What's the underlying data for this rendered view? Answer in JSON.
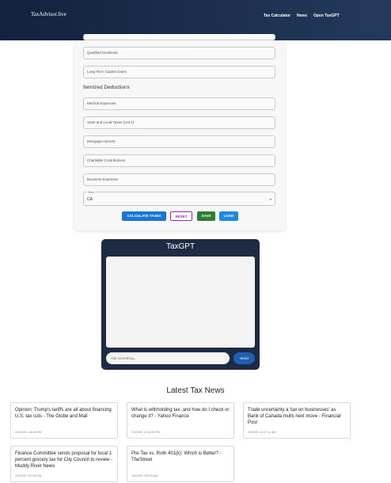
{
  "header": {
    "brand": "TaxAdvisor.live",
    "nav": [
      "Tax Calculator",
      "News",
      "Open TaxGPT"
    ]
  },
  "calculator": {
    "fields": [
      {
        "label": ""
      },
      {
        "label": "Qualified Dividends"
      },
      {
        "label": "Long-Term Capital Gains"
      }
    ],
    "itemized_title": "Itemized Deductions",
    "deductions": [
      {
        "label": "Medical Expenses"
      },
      {
        "label": "State and Local Taxes (SALT)"
      },
      {
        "label": "Mortgage Interest"
      },
      {
        "label": "Charitable Contributions"
      },
      {
        "label": "Business Expenses"
      }
    ],
    "state": {
      "label": "State",
      "value": "CA"
    },
    "buttons": {
      "calculate": "CALCULATE TAXES",
      "reset": "RESET",
      "save": "SAVE",
      "load": "LOAD"
    },
    "colors": {
      "calculate": "#1976d2",
      "reset_border": "#9c27b0",
      "save": "#2e7d32",
      "load": "#1e88e5"
    }
  },
  "taxgpt": {
    "title": "TaxGPT",
    "placeholder": "Ask something...",
    "send": "Send"
  },
  "news": {
    "title": "Latest Tax News",
    "items": [
      {
        "headline": "Opinion: Trump's tariffs are all about financing U.S. tax cuts - The Globe and Mail",
        "date": "2/4/2025, 1:45:30 PM"
      },
      {
        "headline": "What is withholding tax, and how do I check or change it? - Yahoo Finance",
        "date": "2/4/2025, 12:16:25 PM"
      },
      {
        "headline": "Trade uncertainty a 'tax on businesses' as Bank of Canada mulls next move - Financial Post",
        "date": "2/5/2025, 10:27:14 AM"
      },
      {
        "headline": "Finance Committee sends proposal for local 1 percent grocery tax for City Council to review - Muddy River News",
        "date": "2/4/2025, 5:07:55 AM"
      },
      {
        "headline": "Pre-Tax vs. Roth 401(k): Which is Better? - TheStreet",
        "date": "2/5/2025, 9:00:00 AM"
      }
    ]
  }
}
